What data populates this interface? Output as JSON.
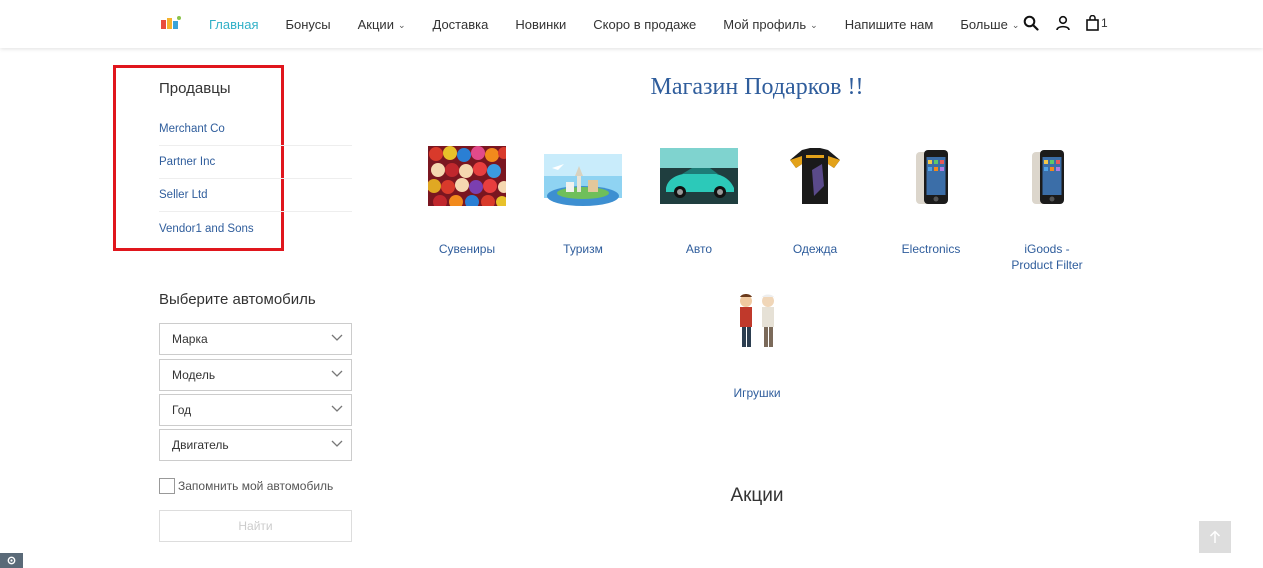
{
  "header": {
    "nav": [
      {
        "label": "Главная",
        "active": true,
        "dropdown": false
      },
      {
        "label": "Бонусы",
        "active": false,
        "dropdown": false
      },
      {
        "label": "Акции",
        "active": false,
        "dropdown": true
      },
      {
        "label": "Доставка",
        "active": false,
        "dropdown": false
      },
      {
        "label": "Новинки",
        "active": false,
        "dropdown": false
      },
      {
        "label": "Скоро в продаже",
        "active": false,
        "dropdown": false
      },
      {
        "label": "Мой профиль",
        "active": false,
        "dropdown": true
      },
      {
        "label": "Напишите нам",
        "active": false,
        "dropdown": false
      },
      {
        "label": "Больше",
        "active": false,
        "dropdown": true
      }
    ],
    "cart_count": "1",
    "icons": [
      "search-icon",
      "user-icon",
      "cart-icon"
    ]
  },
  "sidebar": {
    "sellers_title": "Продавцы",
    "vendors": [
      "Merchant Co",
      "Partner Inc",
      "Seller Ltd",
      "Vendor1 and Sons"
    ],
    "car_title": "Выберите автомобиль",
    "selects": [
      "Марка",
      "Модель",
      "Год",
      "Двигатель"
    ],
    "remember_label": "Запомнить мой автомобиль",
    "find_button": "Найти"
  },
  "main": {
    "title": "Магазин Подарков !!",
    "categories": [
      {
        "label": "Сувениры",
        "icon": "souvenirs-image"
      },
      {
        "label": "Туризм",
        "icon": "tourism-image"
      },
      {
        "label": "Авто",
        "icon": "car-image"
      },
      {
        "label": "Одежда",
        "icon": "jersey-image"
      },
      {
        "label": "Electronics",
        "icon": "phone-image"
      },
      {
        "label": "iGoods - Product Filter",
        "icon": "phone-image"
      },
      {
        "label": "Игрушки",
        "icon": "toys-image"
      }
    ],
    "promo_title": "Акции"
  },
  "colors": {
    "accent": "#31b0c7",
    "link": "#2f5d9c",
    "highlight_border": "#e0161d"
  }
}
